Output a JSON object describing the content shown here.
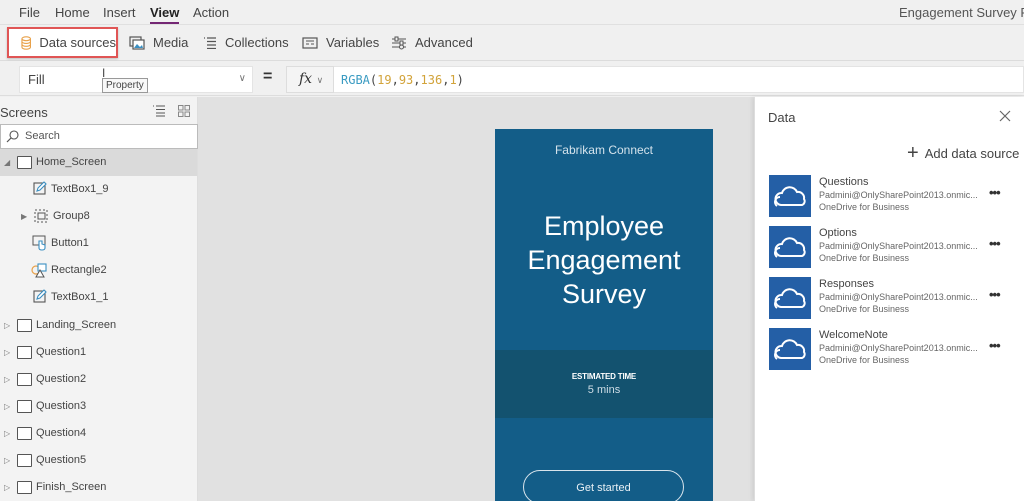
{
  "menu": {
    "items": [
      {
        "label": "File",
        "active": false
      },
      {
        "label": "Home",
        "active": false
      },
      {
        "label": "Insert",
        "active": false
      },
      {
        "label": "View",
        "active": true
      },
      {
        "label": "Action",
        "active": false
      }
    ],
    "app_title": "Engagement Survey Pho"
  },
  "ribbon": {
    "data_sources": "Data sources",
    "media": "Media",
    "collections": "Collections",
    "variables": "Variables",
    "advanced": "Advanced"
  },
  "formula_bar": {
    "property": "Fill",
    "tooltip": "Property",
    "equals": "=",
    "fx": "fx",
    "formula": {
      "function": "RGBA",
      "args": [
        "19",
        "93",
        "136",
        "1"
      ]
    }
  },
  "screens_panel": {
    "title": "Screens",
    "search_placeholder": "Search",
    "tree": [
      {
        "label": "Home_Screen",
        "type": "screen",
        "level": 0,
        "expanded": true,
        "selected": true
      },
      {
        "label": "TextBox1_9",
        "type": "textbox",
        "level": 1
      },
      {
        "label": "Group8",
        "type": "group",
        "level": 1,
        "collapsible": true
      },
      {
        "label": "Button1",
        "type": "button",
        "level": 1
      },
      {
        "label": "Rectangle2",
        "type": "shape",
        "level": 1
      },
      {
        "label": "TextBox1_1",
        "type": "textbox",
        "level": 1
      },
      {
        "label": "Landing_Screen",
        "type": "screen",
        "level": 0
      },
      {
        "label": "Question1",
        "type": "screen",
        "level": 0
      },
      {
        "label": "Question2",
        "type": "screen",
        "level": 0
      },
      {
        "label": "Question3",
        "type": "screen",
        "level": 0
      },
      {
        "label": "Question4",
        "type": "screen",
        "level": 0
      },
      {
        "label": "Question5",
        "type": "screen",
        "level": 0
      },
      {
        "label": "Finish_Screen",
        "type": "screen",
        "level": 0
      }
    ]
  },
  "canvas": {
    "brand": "Fabrikam Connect",
    "title": "Employee Engagement Survey",
    "time_label": "ESTIMATED TIME",
    "time_value": "5 mins",
    "start_button": "Get started",
    "fill_color": "#135d88"
  },
  "data_panel": {
    "title": "Data",
    "add_label": "Add data source",
    "sources": [
      {
        "name": "Questions",
        "account": "Padmini@OnlySharePoint2013.onmic...",
        "type": "OneDrive for Business"
      },
      {
        "name": "Options",
        "account": "Padmini@OnlySharePoint2013.onmic...",
        "type": "OneDrive for Business"
      },
      {
        "name": "Responses",
        "account": "Padmini@OnlySharePoint2013.onmic...",
        "type": "OneDrive for Business"
      },
      {
        "name": "WelcomeNote",
        "account": "Padmini@OnlySharePoint2013.onmic...",
        "type": "OneDrive for Business"
      }
    ]
  },
  "colors": {
    "accent_highlight": "#e05555",
    "tab_underline": "#742774",
    "onedrive_tile": "#245fa6"
  }
}
